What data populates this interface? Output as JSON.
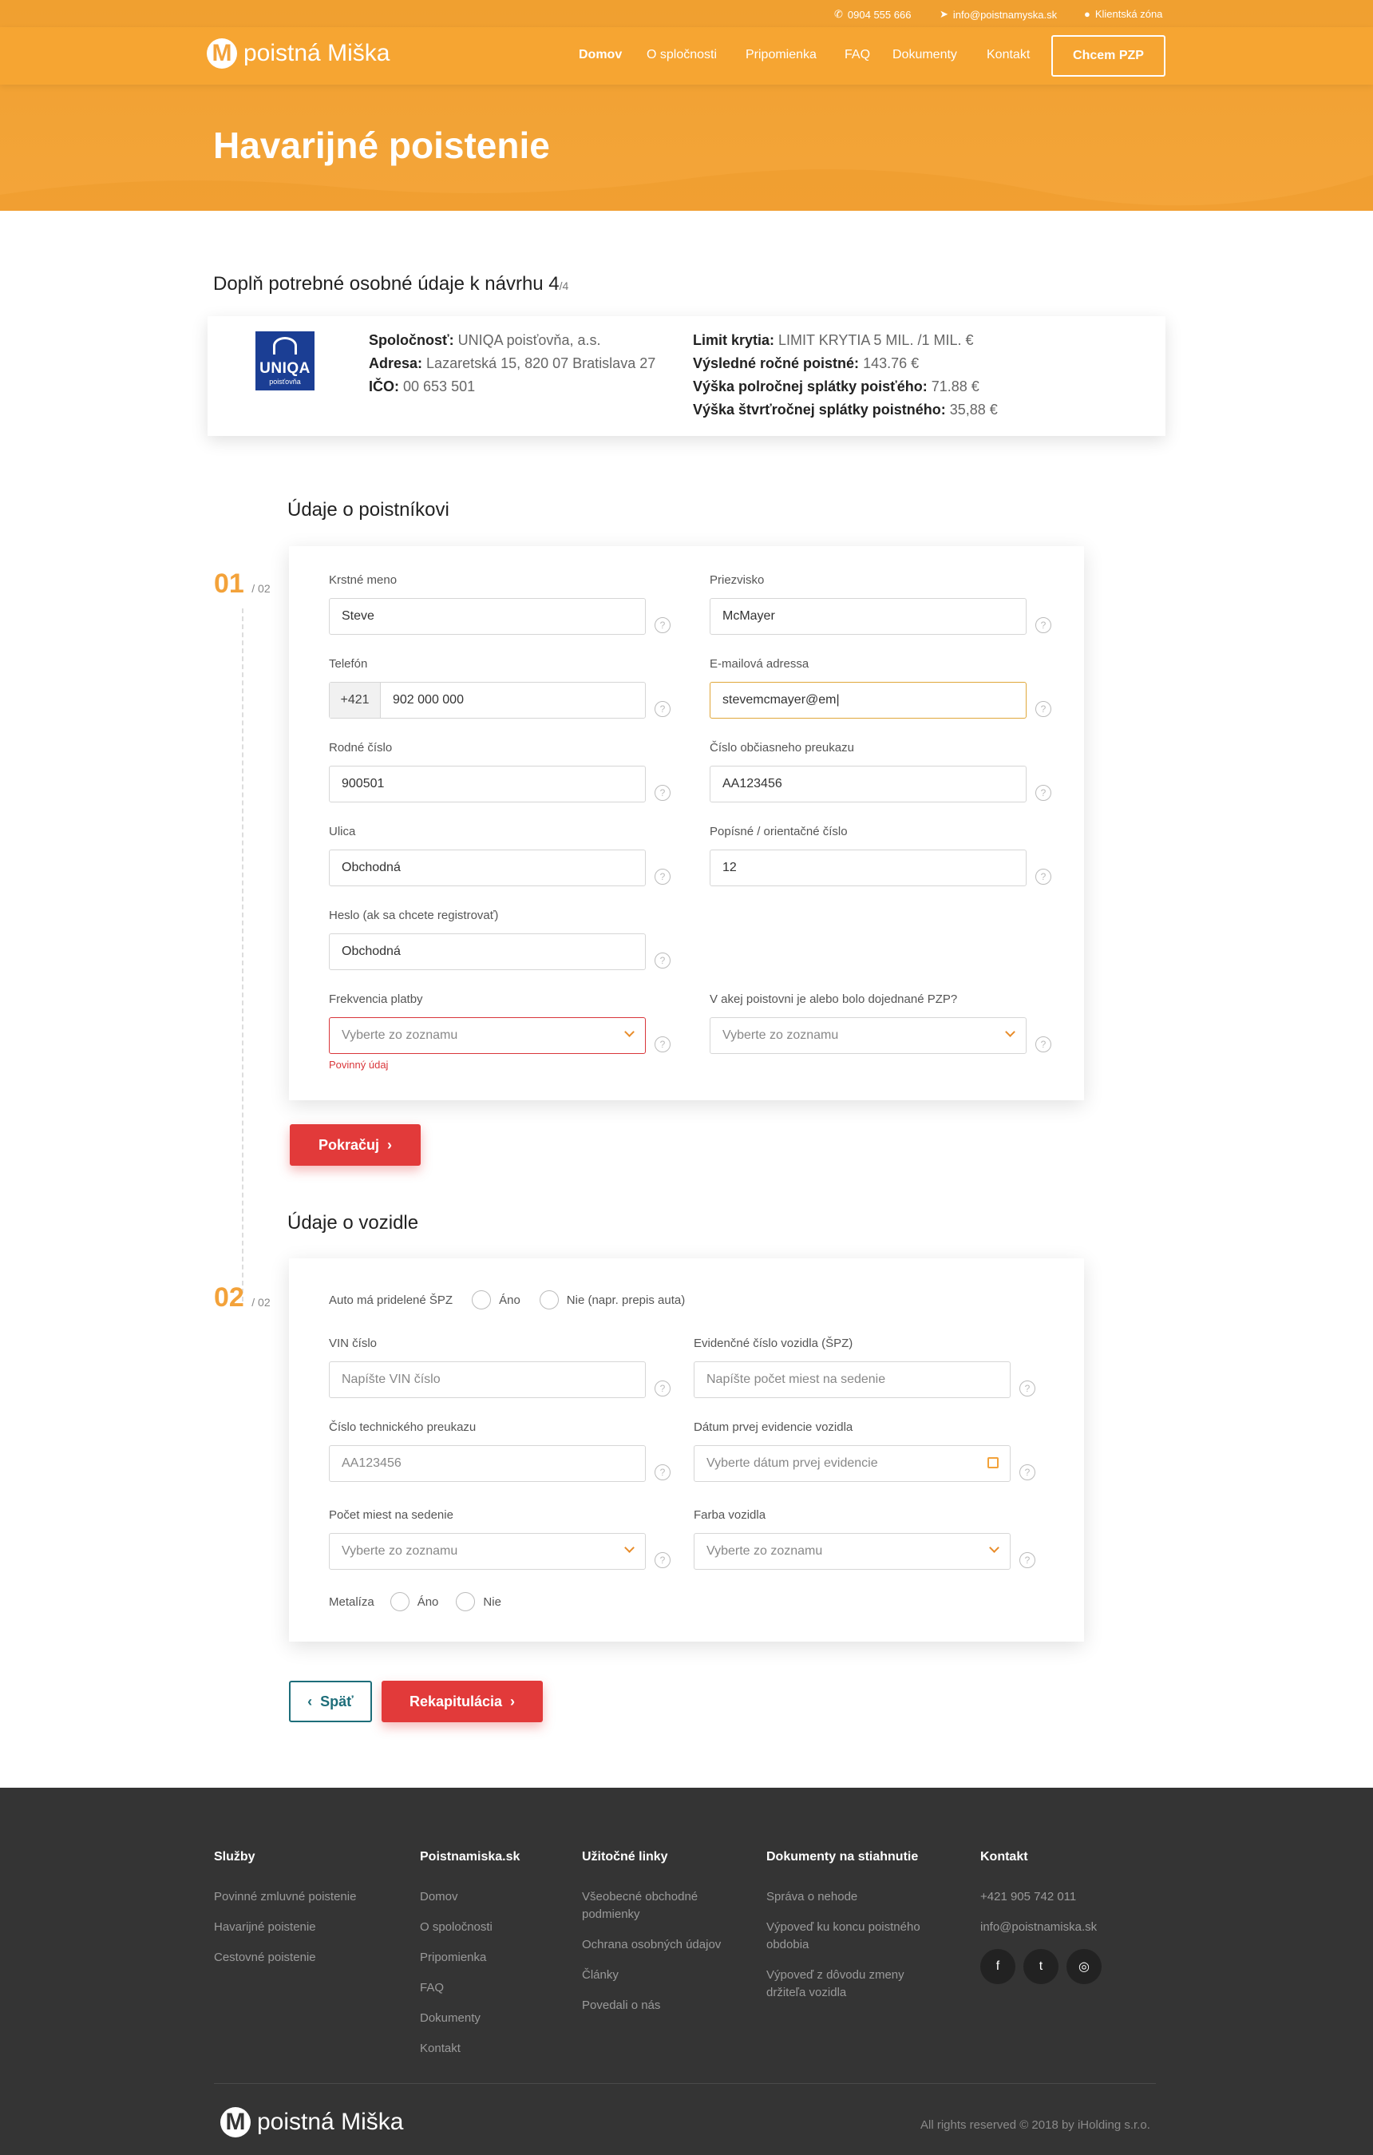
{
  "topbar": {
    "phone": "0904 555 666",
    "email": "info@poistnamyska.sk",
    "client_zone": "Klientská zóna"
  },
  "brand": {
    "logo_text": "poistná Miška",
    "accent": "#f3a23a",
    "cta_red": "#e23a3a"
  },
  "nav": {
    "items": [
      "Domov",
      "O spločnosti",
      "Pripomienka",
      "FAQ",
      "Dokumenty",
      "Kontakt"
    ],
    "cta": "Chcem PZP"
  },
  "hero": {
    "title": "Havarijné poistenie"
  },
  "form_header": {
    "title": "Doplň potrebné osobné údaje k návrhu 4",
    "step": "/4"
  },
  "summary": {
    "insurer_logo": "UNIQA",
    "insurer_logo_sub": "poisťovňa",
    "company_label": "Spoločnosť:",
    "company_value": "UNIQA poisťovňa, a.s.",
    "address_label": "Adresa:",
    "address_value": "Lazaretská 15, 820 07 Bratislava 27",
    "ico_label": "IČO:",
    "ico_value": "00 653 501",
    "limit_label": "Limit krytia:",
    "limit_value": "LIMIT KRYTIA 5 MIL. /1 MIL. €",
    "annual_label": "Výsledné ročné poistné:",
    "annual_value": "143.76 €",
    "half_label": "Výška polročnej splátky poisťého:",
    "half_value": "71.88 €",
    "quarter_label": "Výška štvrťročnej splátky poistného:",
    "quarter_value": "35,88 €"
  },
  "section1": {
    "title": "Údaje o poistníkovi",
    "step_num": "01",
    "step_total": "/ 02",
    "fields": {
      "first_name": {
        "label": "Krstné meno",
        "value": "Steve"
      },
      "last_name": {
        "label": "Priezvisko",
        "value": "McMayer"
      },
      "phone": {
        "label": "Telefón",
        "prefix": "+421",
        "value": "902 000 000"
      },
      "email": {
        "label": "E-mailová adressa",
        "value": "stevemcmayer@em|"
      },
      "birth_no": {
        "label": "Rodné číslo",
        "value": "900501"
      },
      "id_card": {
        "label": "Číslo občiasneho preukazu",
        "value": "AA123456"
      },
      "street": {
        "label": "Ulica",
        "value": "Obchodná"
      },
      "house_no": {
        "label": "Popísné / orientačné číslo",
        "value": "12"
      },
      "password": {
        "label": "Heslo (ak sa chcete registrovať)",
        "value": "Obchodná"
      },
      "pay_freq": {
        "label": "Frekvencia platby",
        "placeholder": "Vyberte zo zoznamu",
        "error": "Povinný údaj"
      },
      "prev_insurer": {
        "label": "V akej poistovni je alebo bolo dojednané PZP?",
        "placeholder": "Vyberte zo zoznamu"
      }
    },
    "continue": "Pokračuj"
  },
  "section2": {
    "title": "Údaje o vozidle",
    "step_num": "02",
    "step_total": "/ 02",
    "plate_question": "Auto má pridelené ŠPZ",
    "yes": "Áno",
    "no_transfer": "Nie (napr. prepis auta)",
    "fields": {
      "vin": {
        "label": "VIN číslo",
        "placeholder": "Napíšte VIN číslo"
      },
      "plate": {
        "label": "Evidenčné číslo vozidla (ŠPZ)",
        "placeholder": "Napíšte počet miest na sedenie"
      },
      "tech_card": {
        "label": "Číslo technického preukazu",
        "value": "AA123456"
      },
      "first_reg": {
        "label": "Dátum prvej evidencie vozidla",
        "placeholder": "Vyberte dátum prvej evidencie"
      },
      "seats": {
        "label": "Počet miest na sedenie",
        "placeholder": "Vyberte zo zoznamu"
      },
      "color": {
        "label": "Farba vozidla",
        "placeholder": "Vyberte zo zoznamu"
      }
    },
    "metallic": "Metalíza",
    "metallic_yes": "Áno",
    "metallic_no": "Nie",
    "back": "Späť",
    "recap": "Rekapitulácia"
  },
  "footer": {
    "col1": {
      "title": "Služby",
      "links": [
        "Povinné zmluvné poistenie",
        "Havarijné poistenie",
        "Cestovné poistenie"
      ]
    },
    "col2": {
      "title": "Poistnamiska.sk",
      "links": [
        "Domov",
        "O spoločnosti",
        "Pripomienka",
        "FAQ",
        "Dokumenty",
        "Kontakt"
      ]
    },
    "col3": {
      "title": "Užitočné linky",
      "links": [
        "Všeobecné obchodné podmienky",
        "Ochrana osobných údajov",
        "Články",
        "Povedali o nás"
      ]
    },
    "col4": {
      "title": "Dokumenty na stiahnutie",
      "links": [
        "Správa o nehode",
        "Výpoveď ku koncu poistného obdobia",
        "Výpoveď z dôvodu zmeny držiteľa vozidla"
      ]
    },
    "col5": {
      "title": "Kontakt",
      "phone": "+421 905 742 011",
      "email": "info@poistnamiska.sk"
    },
    "social": [
      "f",
      "t",
      "◎"
    ],
    "logo_text": "poistná Miška",
    "copyright": "All rights reserved © 2018 by iHolding s.r.o."
  }
}
